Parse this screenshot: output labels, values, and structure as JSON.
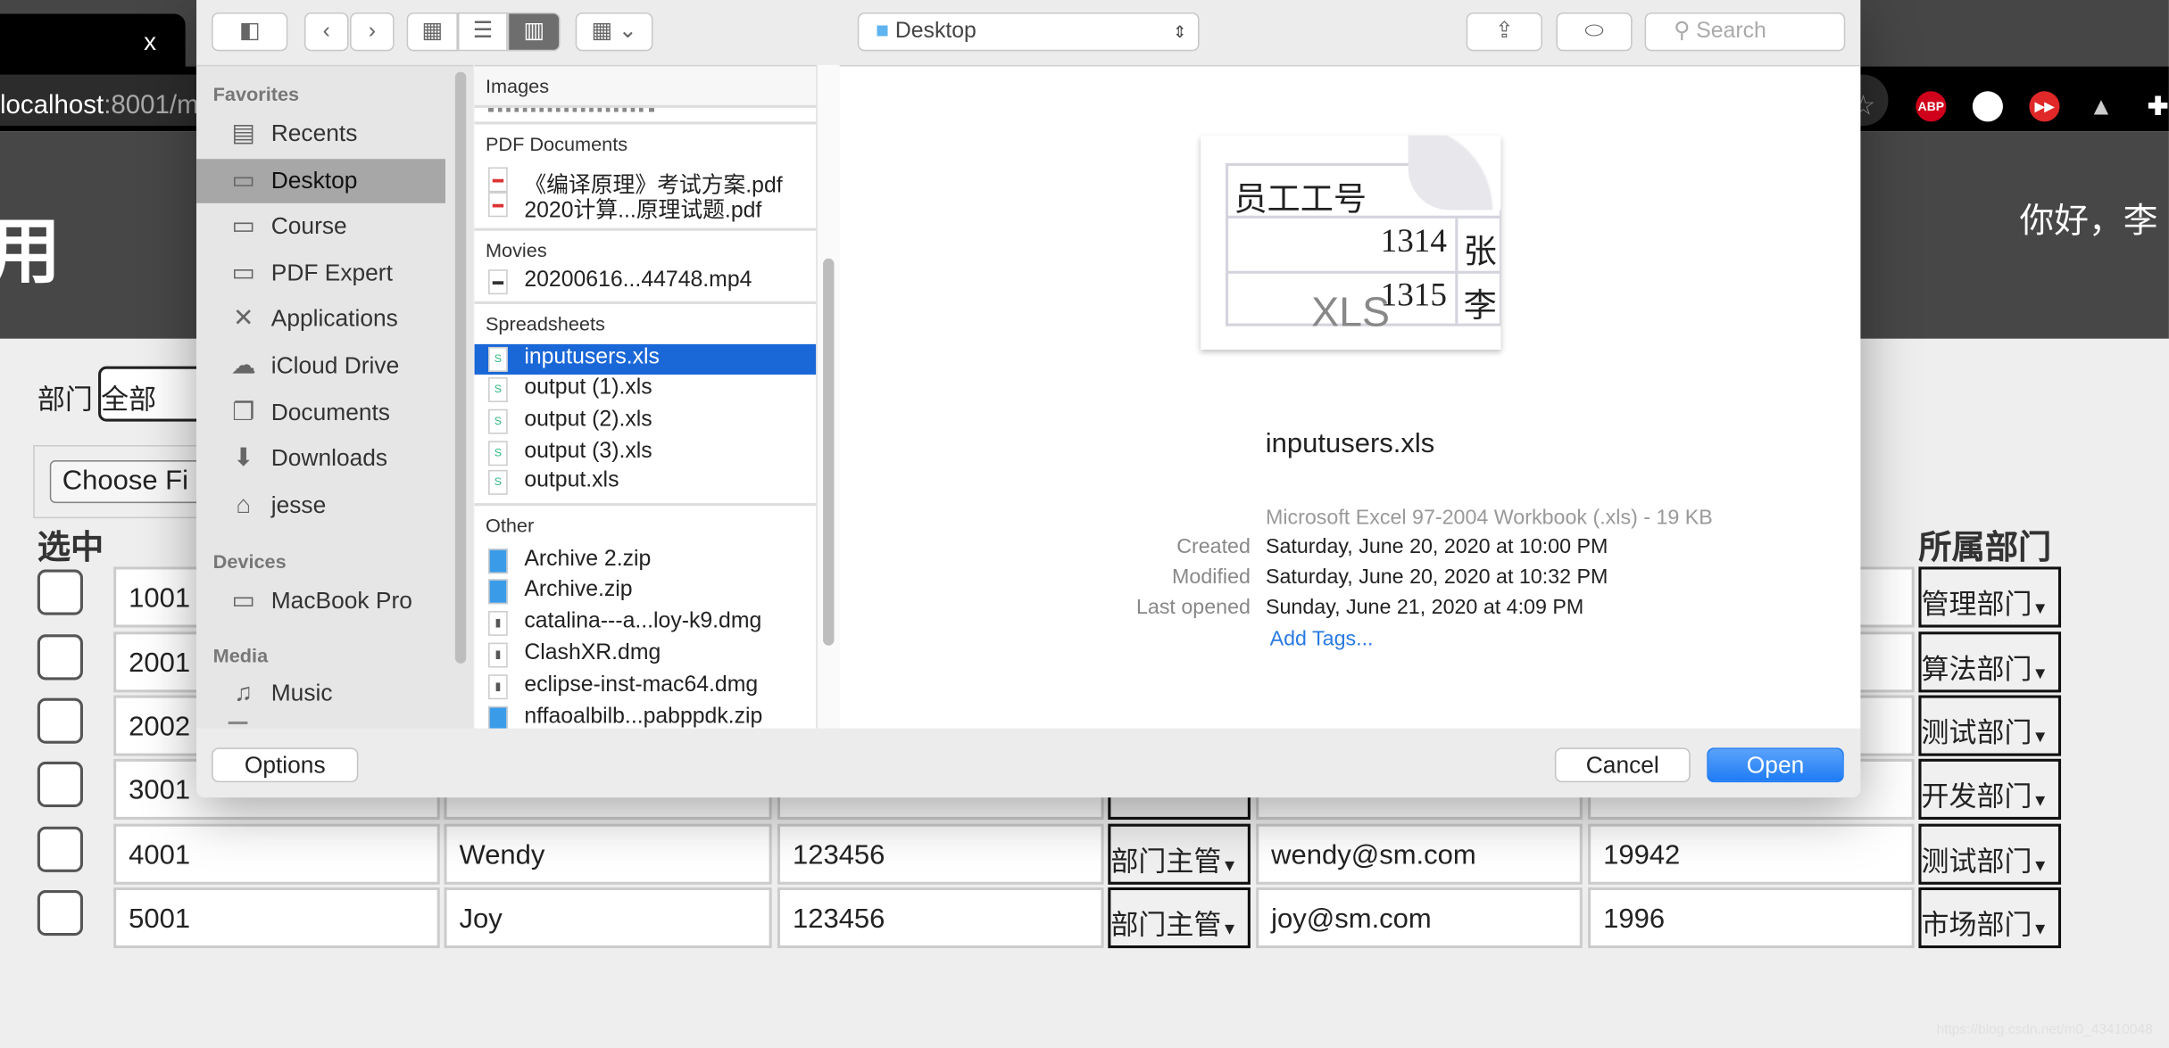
{
  "browser": {
    "tab_close": "x",
    "address_host": "localhost",
    "address_rest": ":8001/m",
    "extensions": [
      {
        "name": "adblock-plus-icon",
        "label": "ABP",
        "color": "#d0021b"
      },
      {
        "name": "extension-egg-icon",
        "label": "",
        "color": "#f08a3c"
      },
      {
        "name": "extension-fastforward-icon",
        "label": "▶▶",
        "color": "#e02828"
      },
      {
        "name": "extension-mountain-icon",
        "label": "▲",
        "color": "#cccccc"
      },
      {
        "name": "extensions-puzzle-icon",
        "label": "✚",
        "color": "#ffffff"
      }
    ]
  },
  "page": {
    "title_fragment": "用",
    "greeting": "你好，李",
    "filter_label": "部门",
    "filter_value": "全部",
    "file_button": "Choose Fi",
    "col_select": "选中",
    "col_dept": "所属部门",
    "rows": [
      {
        "id": "1001",
        "name": "",
        "pwd": "",
        "role": "",
        "email": "",
        "phone": "",
        "dept": "管理部门"
      },
      {
        "id": "2001",
        "name": "",
        "pwd": "",
        "role": "",
        "email": "",
        "phone": "",
        "dept": "算法部门"
      },
      {
        "id": "2002",
        "name": "",
        "pwd": "",
        "role": "",
        "email": "",
        "phone": "",
        "dept": "测试部门"
      },
      {
        "id": "3001",
        "name": "",
        "pwd": "",
        "role": "",
        "email": "",
        "phone": "",
        "dept": "开发部门"
      },
      {
        "id": "4001",
        "name": "Wendy",
        "pwd": "123456",
        "role": "部门主管",
        "email": "wendy@sm.com",
        "phone": "19942",
        "dept": "测试部门"
      },
      {
        "id": "5001",
        "name": "Joy",
        "pwd": "123456",
        "role": "部门主管",
        "email": "joy@sm.com",
        "phone": "1996",
        "dept": "市场部门"
      }
    ],
    "watermark": "https://blog.csdn.net/m0_43410048"
  },
  "dialog": {
    "location": "Desktop",
    "search_placeholder": "Search",
    "sidebar": {
      "favorites_header": "Favorites",
      "favorites": [
        {
          "label": "Recents",
          "icon": "recents-icon",
          "glyph": "▤"
        },
        {
          "label": "Desktop",
          "icon": "desktop-icon",
          "glyph": "▭",
          "selected": true
        },
        {
          "label": "Course",
          "icon": "folder-icon",
          "glyph": "▭"
        },
        {
          "label": "PDF Expert",
          "icon": "folder-icon",
          "glyph": "▭"
        },
        {
          "label": "Applications",
          "icon": "applications-icon",
          "glyph": "✕"
        },
        {
          "label": "iCloud Drive",
          "icon": "cloud-icon",
          "glyph": "☁"
        },
        {
          "label": "Documents",
          "icon": "documents-icon",
          "glyph": "❐"
        },
        {
          "label": "Downloads",
          "icon": "downloads-icon",
          "glyph": "⬇"
        },
        {
          "label": "jesse",
          "icon": "home-icon",
          "glyph": "⌂"
        }
      ],
      "devices_header": "Devices",
      "devices": [
        {
          "label": "MacBook Pro",
          "icon": "laptop-icon",
          "glyph": "▭"
        }
      ],
      "media_header": "Media",
      "media": [
        {
          "label": "Music",
          "icon": "music-icon",
          "glyph": "♫"
        }
      ]
    },
    "groups": [
      {
        "title": "Images",
        "files": []
      },
      {
        "title": "PDF Documents",
        "files": [
          {
            "name": "《编译原理》考试方案.pdf",
            "type": "pdf"
          },
          {
            "name": "2020计算...原理试题.pdf",
            "type": "pdf"
          }
        ]
      },
      {
        "title": "Movies",
        "files": [
          {
            "name": "20200616...44748.mp4",
            "type": "movie"
          }
        ]
      },
      {
        "title": "Spreadsheets",
        "files": [
          {
            "name": "inputusers.xls",
            "type": "xls",
            "selected": true
          },
          {
            "name": "output (1).xls",
            "type": "xls"
          },
          {
            "name": "output (2).xls",
            "type": "xls"
          },
          {
            "name": "output (3).xls",
            "type": "xls"
          },
          {
            "name": "output.xls",
            "type": "xls"
          }
        ]
      },
      {
        "title": "Other",
        "files": [
          {
            "name": "Archive 2.zip",
            "type": "zip"
          },
          {
            "name": "Archive.zip",
            "type": "zip"
          },
          {
            "name": "catalina---a...loy-k9.dmg",
            "type": "dmg"
          },
          {
            "name": "ClashXR.dmg",
            "type": "dmg"
          },
          {
            "name": "eclipse-inst-mac64.dmg",
            "type": "dmg"
          },
          {
            "name": "nffaoalbilb...pabppdk.zip",
            "type": "zip"
          }
        ]
      }
    ],
    "preview": {
      "thumb_header": "员工工号",
      "thumb_r1": "1314",
      "thumb_r1b": "张",
      "thumb_r2": "1315",
      "thumb_r2b": "李",
      "thumb_badge": "XLS",
      "name": "inputusers.xls",
      "kind": "Microsoft Excel 97-2004 Workbook (.xls) - 19 KB",
      "meta": [
        {
          "label": "Created",
          "value": "Saturday, June 20, 2020 at 10:00 PM"
        },
        {
          "label": "Modified",
          "value": "Saturday, June 20, 2020 at 10:32 PM"
        },
        {
          "label": "Last opened",
          "value": "Sunday, June 21, 2020 at 4:09 PM"
        }
      ],
      "add_tags": "Add Tags..."
    },
    "options_label": "Options",
    "cancel_label": "Cancel",
    "open_label": "Open",
    "accent": "#1f7cf4",
    "selection": "#1a67d8"
  }
}
